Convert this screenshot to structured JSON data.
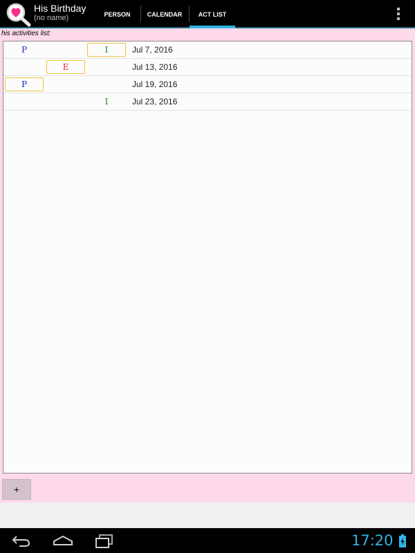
{
  "actionbar": {
    "title": "His Birthday",
    "subtitle": "(no name)",
    "app_icon": "heart-magnifier-icon",
    "overflow_icon": "overflow-menu-icon",
    "tabs": [
      {
        "label": "PERSON",
        "selected": false
      },
      {
        "label": "CALENDAR",
        "selected": false
      },
      {
        "label": "ACT LIST",
        "selected": true
      }
    ],
    "accent_color": "#33b5e5"
  },
  "main": {
    "list_label": "his activities list:",
    "background_color": "#fdd9e9",
    "rows": [
      {
        "marks": [
          {
            "letter": "P",
            "type": "p",
            "framed": false
          },
          {
            "letter": "I",
            "type": "i",
            "framed": true
          }
        ],
        "date": "Jul 7, 2016"
      },
      {
        "marks": [
          {
            "letter": "E",
            "type": "e",
            "framed": true
          }
        ],
        "date": "Jul 13, 2016"
      },
      {
        "marks": [
          {
            "letter": "P",
            "type": "p",
            "framed": true
          }
        ],
        "date": "Jul 19, 2016"
      },
      {
        "marks": [
          {
            "letter": "I",
            "type": "i",
            "framed": false
          }
        ],
        "date": "Jul 23, 2016"
      }
    ],
    "add_button_label": "+"
  },
  "system_bar": {
    "clock": "17:20",
    "back_icon": "back-icon",
    "home_icon": "home-icon",
    "recents_icon": "recents-icon",
    "battery_icon": "battery-charging-icon"
  }
}
